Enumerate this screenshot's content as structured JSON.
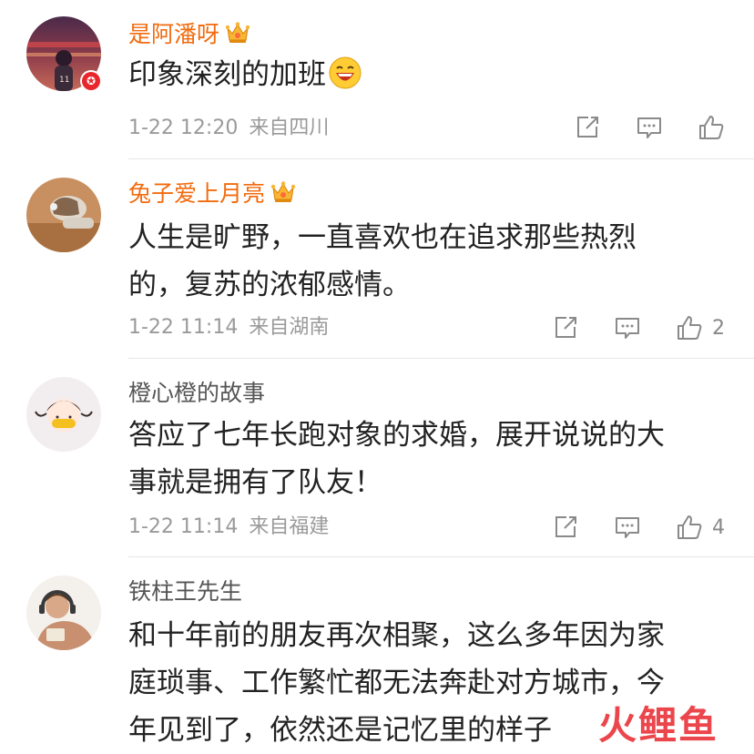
{
  "comments": [
    {
      "username": "是阿潘呀",
      "vip": true,
      "text_lines": [
        "印象深刻的加班"
      ],
      "emoji": "laughing-emoji",
      "date": "1-22 12:20",
      "source": "来自四川",
      "likes": ""
    },
    {
      "username": "兔子爱上月亮",
      "vip": true,
      "text_lines": [
        "人生是旷野，一直喜欢也在追求那些热烈",
        "的，复苏的浓郁感情。"
      ],
      "date": "1-22 11:14",
      "source": "来自湖南",
      "likes": "2"
    },
    {
      "username": "橙心橙的故事",
      "vip": false,
      "text_lines": [
        "答应了七年长跑对象的求婚，展开说说的大",
        "事就是拥有了队友！"
      ],
      "date": "1-22 11:14",
      "source": "来自福建",
      "likes": "4"
    },
    {
      "username": "铁柱王先生",
      "vip": false,
      "text_lines": [
        "和十年前的朋友再次相聚，这么多年因为家",
        "庭琐事、工作繁忙都无法奔赴对方城市，今",
        "年见到了，依然还是记忆里的样子"
      ]
    }
  ],
  "icons": {
    "repost": "repost-icon",
    "comment": "comment-icon",
    "like": "like-icon",
    "crown": "vip-crown-icon",
    "verified": "verified-badge-icon"
  },
  "colors": {
    "vip_name": "#f26b0f",
    "plain_name": "#555555",
    "body_text": "#222222",
    "meta_text": "#9a9a9a",
    "watermark": "#e8262d"
  },
  "watermark": "火鲤鱼"
}
